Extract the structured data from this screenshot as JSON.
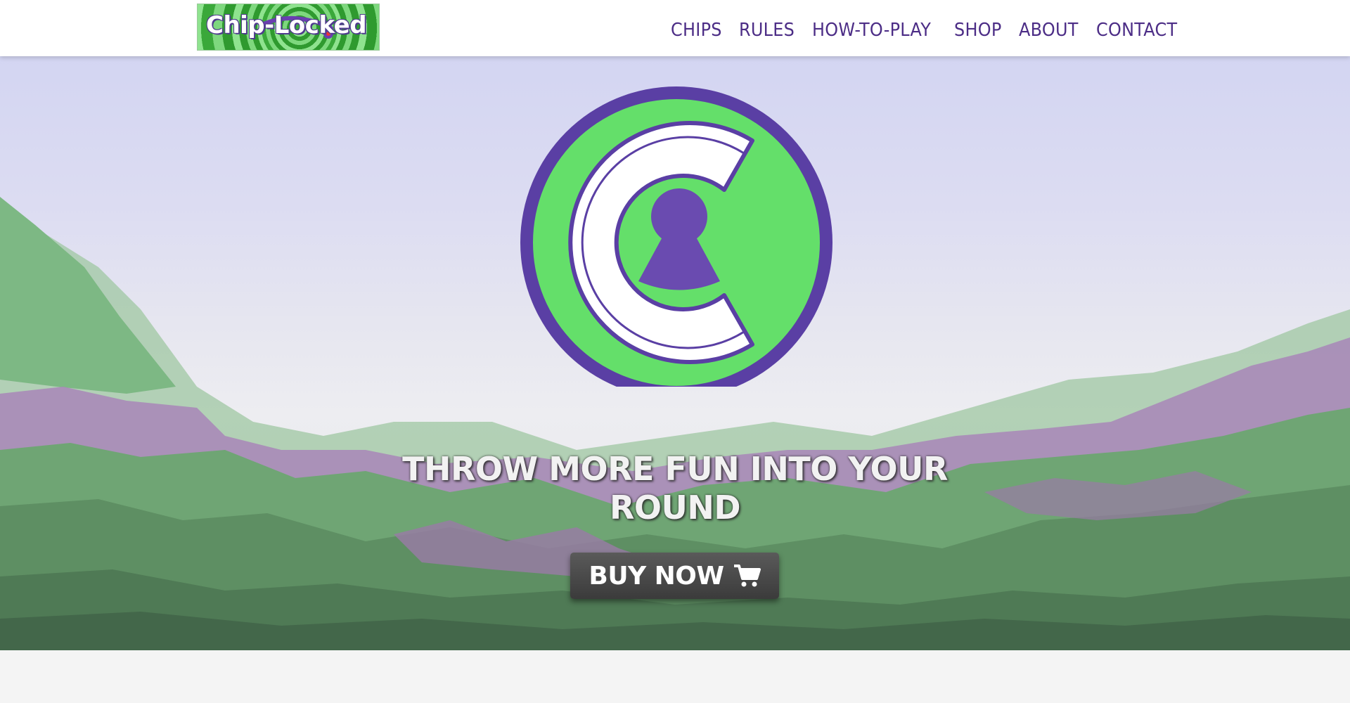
{
  "header": {
    "logo_text": "Chip-Locked",
    "nav": [
      {
        "label": "CHIPS"
      },
      {
        "label": "RULES"
      },
      {
        "label": "HOW-TO-PLAY"
      },
      {
        "label": "SHOP"
      },
      {
        "label": "ABOUT"
      },
      {
        "label": "CONTACT"
      }
    ]
  },
  "hero": {
    "headline": "THROW MORE FUN INTO YOUR ROUND",
    "buy_button": {
      "label": "BUY NOW",
      "icon": "shopping-cart-icon"
    },
    "emblem_icon": "chip-locked-keyhole-emblem"
  },
  "colors": {
    "brand_purple": "#4c2d86",
    "brand_green": "#64df6a",
    "button_dark": "#3b3b3b"
  }
}
